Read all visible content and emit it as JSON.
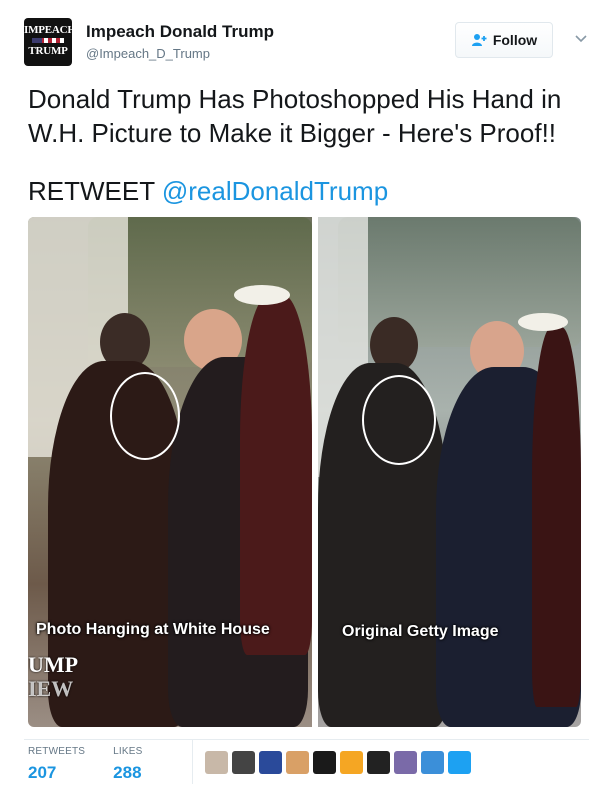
{
  "account": {
    "display_name": "Impeach Donald Trump",
    "handle": "@Impeach_D_Trump",
    "avatar_text_top": "IMPEACH",
    "avatar_text_bottom": "TRUMP"
  },
  "follow_button": {
    "label": "Follow",
    "icon": "add-user-icon"
  },
  "caret_icon": "chevron-down-icon",
  "tweet": {
    "text": "Donald Trump Has Photoshopped His Hand in W.H. Picture to Make it Bigger - Here's Proof!!",
    "retweet_prefix": "RETWEET ",
    "mention": "@realDonaldTrump"
  },
  "media": {
    "left_caption": "Photo Hanging at White House",
    "right_caption": "Original Getty Image",
    "left_watermark_line1": "UMP",
    "left_watermark_line2": "IEW"
  },
  "stats": {
    "retweets_label": "RETWEETS",
    "retweets_value": "207",
    "likes_label": "LIKES",
    "likes_value": "288"
  },
  "likers_count": 10,
  "colors": {
    "link": "#1b95e0",
    "follow_icon": "#1da1f2",
    "liker_avatars": [
      "#c8b8a8",
      "#444444",
      "#2a4a9a",
      "#d9a066",
      "#1a1a1a",
      "#f5a623",
      "#222222",
      "#7a6aa8",
      "#3b8fd9",
      "#1da1f2"
    ]
  }
}
